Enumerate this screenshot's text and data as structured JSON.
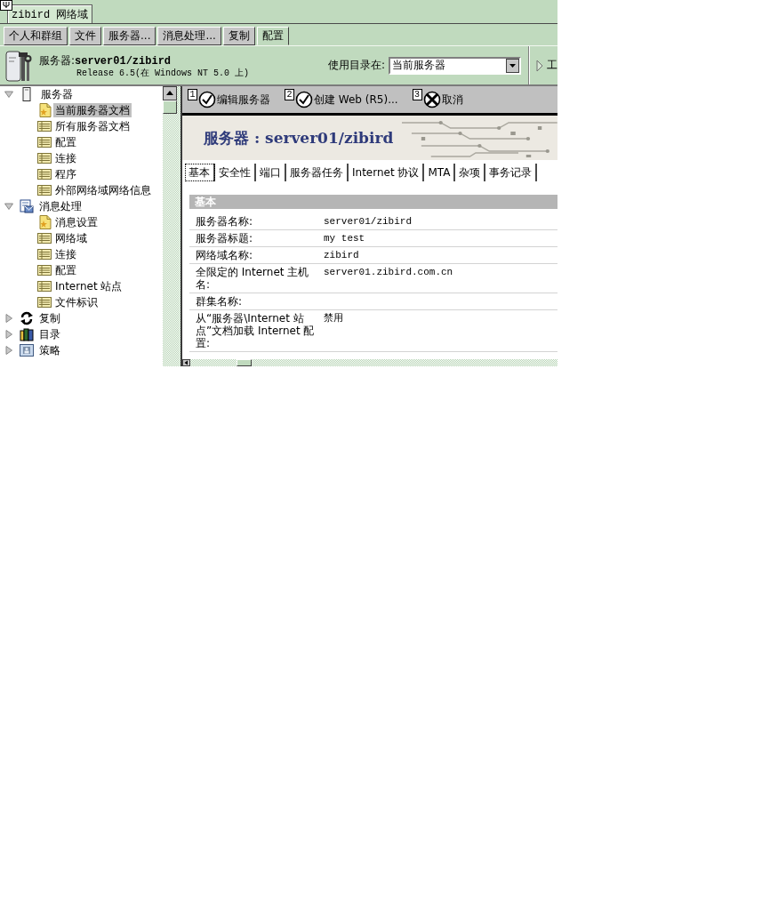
{
  "window_tab": {
    "label": "zibird 网络域"
  },
  "menu_tabs": [
    {
      "label": "个人和群组",
      "selected": false
    },
    {
      "label": "文件",
      "selected": false
    },
    {
      "label": "服务器...",
      "selected": false
    },
    {
      "label": "消息处理...",
      "selected": false
    },
    {
      "label": "复制",
      "selected": false
    },
    {
      "label": "配置",
      "selected": true
    }
  ],
  "header": {
    "title": "服务器:**server01/zibird**",
    "release": "Release 6.5(在 Windows NT 5.0 上)",
    "directory_label": "使用目录在:",
    "directory_value": "当前服务器",
    "tools_label": "工"
  },
  "sidebar": {
    "items": [
      {
        "label": "服务器",
        "kind": "server",
        "expanded": true,
        "selected": false,
        "children": [
          {
            "label": "当前服务器文档",
            "kind": "document",
            "selected": true
          },
          {
            "label": "所有服务器文档",
            "kind": "view",
            "selected": false
          },
          {
            "label": "配置",
            "kind": "view",
            "selected": false
          },
          {
            "label": "连接",
            "kind": "view",
            "selected": false
          },
          {
            "label": "程序",
            "kind": "view",
            "selected": false
          },
          {
            "label": "外部网络域网络信息",
            "kind": "view",
            "selected": false
          }
        ]
      },
      {
        "label": "消息处理",
        "kind": "messaging",
        "expanded": true,
        "selected": false,
        "children": [
          {
            "label": "消息设置",
            "kind": "document",
            "selected": false
          },
          {
            "label": "网络域",
            "kind": "view",
            "selected": false
          },
          {
            "label": "连接",
            "kind": "view",
            "selected": false
          },
          {
            "label": "配置",
            "kind": "view",
            "selected": false
          },
          {
            "label": "Internet 站点",
            "kind": "view",
            "selected": false
          },
          {
            "label": "文件标识",
            "kind": "view",
            "selected": false
          }
        ]
      },
      {
        "label": "复制",
        "kind": "replication",
        "expanded": false,
        "selected": false
      },
      {
        "label": "目录",
        "kind": "directory",
        "expanded": false,
        "selected": false
      },
      {
        "label": "策略",
        "kind": "policy",
        "expanded": false,
        "selected": false
      }
    ]
  },
  "toolbar": {
    "buttons": [
      {
        "number": "1",
        "label": "编辑服务器",
        "kind": "edit"
      },
      {
        "number": "2",
        "label": "创建 Web (R5)...",
        "kind": "create"
      },
      {
        "number": "3",
        "label": "取消",
        "kind": "cancel"
      }
    ]
  },
  "banner": {
    "title": "服务器 : server01/zibird"
  },
  "form_tabs": [
    {
      "label": "基本",
      "selected": true
    },
    {
      "label": "安全性",
      "selected": false
    },
    {
      "label": "端口",
      "selected": false
    },
    {
      "label": "服务器任务",
      "selected": false
    },
    {
      "label": "Internet 协议",
      "selected": false
    },
    {
      "label": "MTA",
      "selected": false
    },
    {
      "label": "杂项",
      "selected": false
    },
    {
      "label": "事务记录",
      "selected": false
    }
  ],
  "section": {
    "title": "基本",
    "rows": [
      {
        "label": "服务器名称:",
        "value": "server01/zibird"
      },
      {
        "label": "服务器标题:",
        "value": "my test"
      },
      {
        "label": "网络域名称:",
        "value": "zibird"
      },
      {
        "label": "全限定的 Internet 主机名:",
        "value": "server01.zibird.com.cn"
      },
      {
        "label": "群集名称:"
      },
      {
        "label": "从“服务器\\Internet 站点”文档加载 Internet 配置:",
        "value": "禁用"
      }
    ]
  }
}
